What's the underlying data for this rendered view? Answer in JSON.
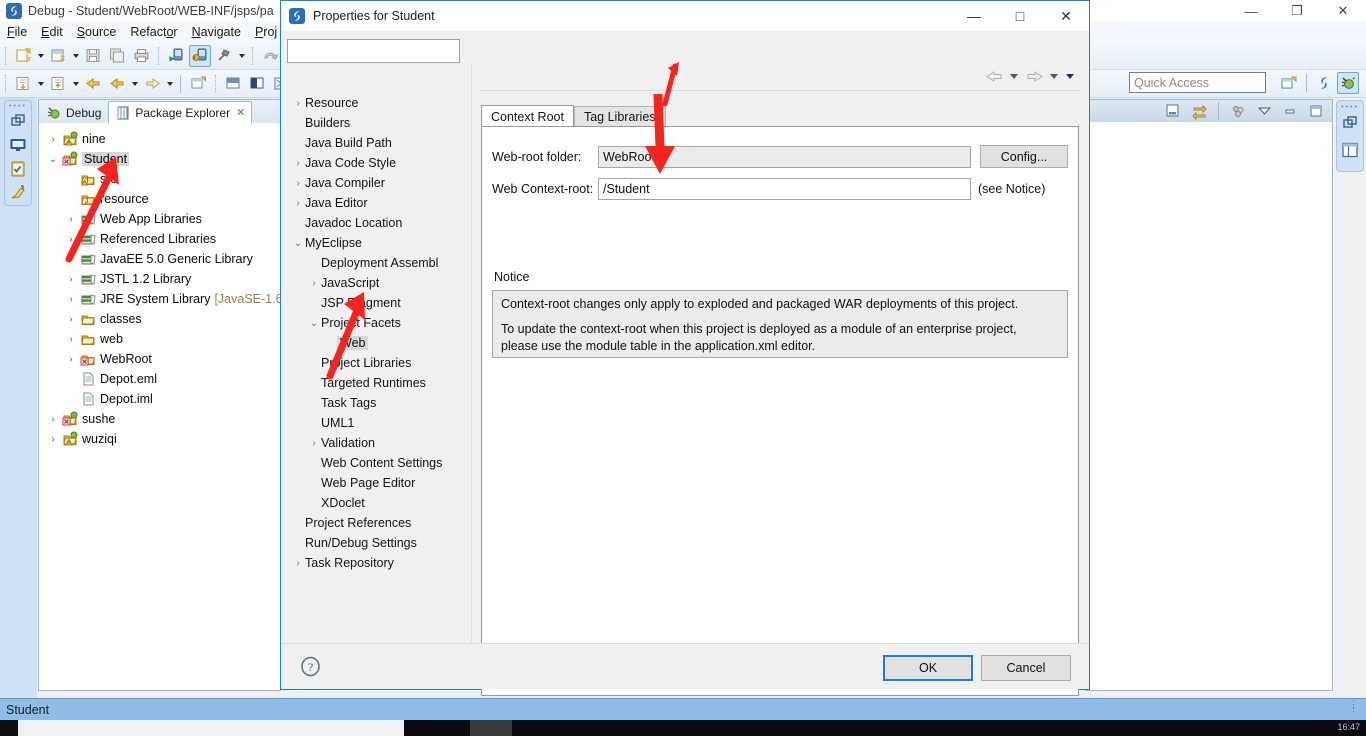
{
  "ide": {
    "title": "Debug - Student/WebRoot/WEB-INF/jsps/pa",
    "title_icon": "myeclipse-icon",
    "window_controls": {
      "minimize": "—",
      "restore": "❐",
      "close": "✕"
    },
    "menu": [
      {
        "label": "File",
        "mnemonic": "F"
      },
      {
        "label": "Edit",
        "mnemonic": "E"
      },
      {
        "label": "Source",
        "mnemonic": "S"
      },
      {
        "label": "Refactor",
        "mnemonic": "o"
      },
      {
        "label": "Navigate",
        "mnemonic": "N"
      },
      {
        "label": "Proj",
        "mnemonic": "P"
      }
    ],
    "quick_access": {
      "placeholder": "Quick Access",
      "value": ""
    },
    "status_bar": {
      "text": "Student"
    },
    "taskbar": {
      "clock": "16:47"
    }
  },
  "package_explorer": {
    "tabs": [
      {
        "label": "Debug",
        "icon": "debug-icon",
        "active": false,
        "closable": false
      },
      {
        "label": "Package Explorer",
        "icon": "package-explorer-icon",
        "active": true,
        "closable": true,
        "close_glyph": "✕"
      }
    ],
    "tree": [
      {
        "indent": 0,
        "twist": "collapsed",
        "icon": "project-warning-icon",
        "label": "nine"
      },
      {
        "indent": 0,
        "twist": "expanded",
        "icon": "project-error-icon",
        "label": "Student",
        "selected": true
      },
      {
        "indent": 1,
        "twist": "none",
        "icon": "source-folder-warning-icon",
        "label": "src"
      },
      {
        "indent": 1,
        "twist": "none",
        "icon": "source-folder-icon",
        "label": "resource"
      },
      {
        "indent": 1,
        "twist": "collapsed",
        "icon": "library-icon",
        "label": "Web App Libraries"
      },
      {
        "indent": 1,
        "twist": "collapsed",
        "icon": "library-icon",
        "label": "Referenced Libraries"
      },
      {
        "indent": 1,
        "twist": "collapsed",
        "icon": "library-icon",
        "label": "JavaEE 5.0 Generic Library"
      },
      {
        "indent": 1,
        "twist": "collapsed",
        "icon": "library-icon",
        "label": "JSTL 1.2 Library"
      },
      {
        "indent": 1,
        "twist": "collapsed",
        "icon": "library-icon",
        "label": "JRE System Library",
        "suffix": "[JavaSE-1.6"
      },
      {
        "indent": 1,
        "twist": "collapsed",
        "icon": "folder-icon",
        "label": "classes"
      },
      {
        "indent": 1,
        "twist": "collapsed",
        "icon": "folder-icon",
        "label": "web"
      },
      {
        "indent": 1,
        "twist": "collapsed",
        "icon": "folder-error-icon",
        "label": "WebRoot"
      },
      {
        "indent": 1,
        "twist": "none",
        "icon": "file-icon",
        "label": "Depot.eml"
      },
      {
        "indent": 1,
        "twist": "none",
        "icon": "file-icon",
        "label": "Depot.iml"
      },
      {
        "indent": 0,
        "twist": "collapsed",
        "icon": "project-error-icon",
        "label": "sushe"
      },
      {
        "indent": 0,
        "twist": "collapsed",
        "icon": "project-warning-icon",
        "label": "wuziqi"
      }
    ]
  },
  "dialog": {
    "title": "Properties for Student",
    "title_icon": "myeclipse-icon",
    "window_controls": {
      "minimize": "—",
      "maximize": "□",
      "close": "✕"
    },
    "filter": {
      "value": "",
      "placeholder": ""
    },
    "nav": [
      {
        "twist": "collapsed",
        "indent": 0,
        "label": "Resource"
      },
      {
        "twist": "none",
        "indent": 0,
        "label": "Builders"
      },
      {
        "twist": "none",
        "indent": 0,
        "label": "Java Build Path"
      },
      {
        "twist": "collapsed",
        "indent": 0,
        "label": "Java Code Style"
      },
      {
        "twist": "collapsed",
        "indent": 0,
        "label": "Java Compiler"
      },
      {
        "twist": "collapsed",
        "indent": 0,
        "label": "Java Editor"
      },
      {
        "twist": "none",
        "indent": 0,
        "label": "Javadoc Location"
      },
      {
        "twist": "expanded",
        "indent": 0,
        "label": "MyEclipse"
      },
      {
        "twist": "none",
        "indent": 1,
        "label": "Deployment Assembl"
      },
      {
        "twist": "collapsed",
        "indent": 1,
        "label": "JavaScript"
      },
      {
        "twist": "none",
        "indent": 1,
        "label": "JSP Fragment"
      },
      {
        "twist": "expanded",
        "indent": 1,
        "label": "Project Facets"
      },
      {
        "twist": "none",
        "indent": 2,
        "label": "Web",
        "selected": true
      },
      {
        "twist": "none",
        "indent": 1,
        "label": "Project Libraries"
      },
      {
        "twist": "none",
        "indent": 1,
        "label": "Targeted Runtimes"
      },
      {
        "twist": "none",
        "indent": 1,
        "label": "Task Tags"
      },
      {
        "twist": "none",
        "indent": 1,
        "label": "UML1"
      },
      {
        "twist": "collapsed",
        "indent": 1,
        "label": "Validation"
      },
      {
        "twist": "none",
        "indent": 1,
        "label": "Web Content Settings"
      },
      {
        "twist": "none",
        "indent": 1,
        "label": "Web Page Editor"
      },
      {
        "twist": "none",
        "indent": 1,
        "label": "XDoclet"
      },
      {
        "twist": "none",
        "indent": 0,
        "label": "Project References"
      },
      {
        "twist": "none",
        "indent": 0,
        "label": "Run/Debug Settings"
      },
      {
        "twist": "collapsed",
        "indent": 0,
        "label": "Task Repository"
      }
    ],
    "tabs": [
      {
        "label": "Context Root",
        "active": true
      },
      {
        "label": "Tag Libraries",
        "active": false
      }
    ],
    "form": {
      "webroot_folder_label": "Web-root folder:",
      "webroot_folder_value": "WebRoot",
      "config_button": "Config...",
      "context_root_label": "Web Context-root:",
      "context_root_value": "/Student",
      "see_notice": "(see Notice)"
    },
    "notice": {
      "heading": "Notice",
      "lines": [
        "Context-root changes only apply to exploded and packaged WAR deployments of this project.",
        "",
        "To update the context-root when this project is deployed as a module of an enterprise project,",
        "please use the module table in the application.xml editor."
      ]
    },
    "footer": {
      "help_icon": "help-question-icon",
      "ok": "OK",
      "cancel": "Cancel"
    }
  },
  "colors": {
    "dialog_accent": "#1b7fd4",
    "status_bar": "#8fbde8",
    "annotation_arrow": "#f5241c",
    "selection_grey": "#d6d6d6"
  }
}
